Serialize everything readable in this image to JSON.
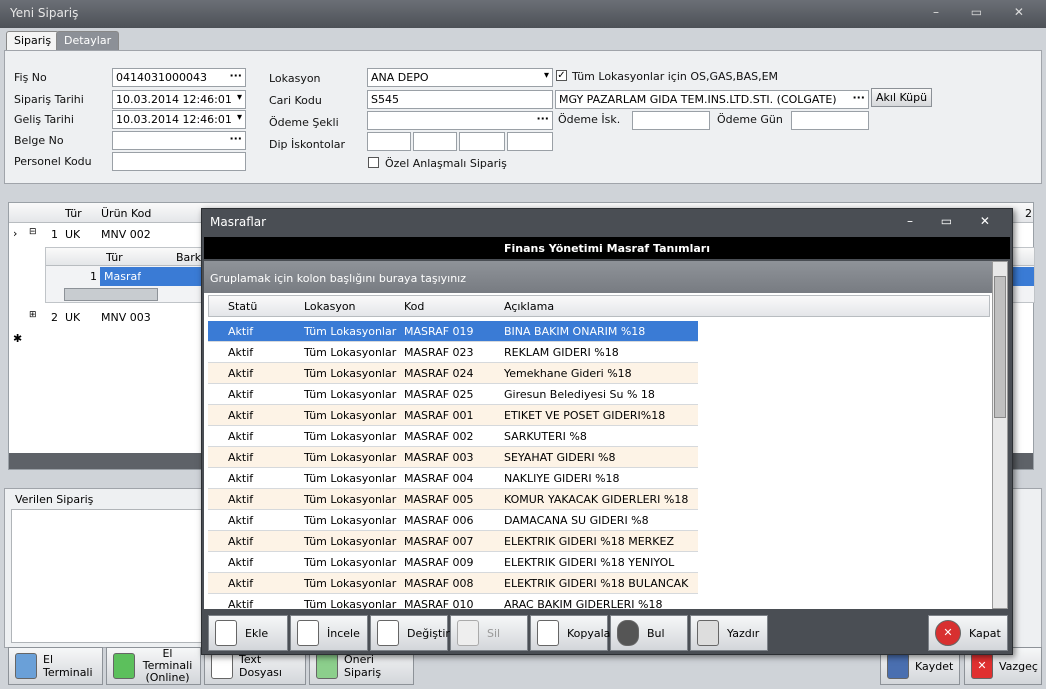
{
  "window": {
    "title": "Yeni Sipariş"
  },
  "tabs": [
    {
      "label": "Sipariş"
    },
    {
      "label": "Detaylar"
    }
  ],
  "form": {
    "fis_no_label": "Fiş No",
    "fis_no": "0414031000043",
    "siparis_tarihi_label": "Sipariş Tarihi",
    "siparis_tarihi": "10.03.2014 12:46:01",
    "gelis_tarihi_label": "Geliş Tarihi",
    "gelis_tarihi": "10.03.2014 12:46:01",
    "belge_no_label": "Belge No",
    "belge_no": "",
    "personel_kodu_label": "Personel Kodu",
    "personel_kodu": "",
    "lokasyon_label": "Lokasyon",
    "lokasyon": "ANA DEPO",
    "cari_kodu_label": "Cari Kodu",
    "cari_kodu": "S545",
    "cari_unvan": "MGY PAZARLAM GIDA TEM.INS.LTD.STI. (COLGATE)",
    "odeme_sekli_label": "Ödeme Şekli",
    "odeme_sekli": "",
    "dip_iskontolar_label": "Dip İskontolar",
    "tum_lokasyonlar_label": "Tüm Lokasyonlar için OS,GAS,BAS,EM",
    "tum_lokasyonlar_checked": true,
    "ozel_anlasmali_label": "Özel Anlaşmalı Sipariş",
    "ozel_anlasmali_checked": false,
    "akil_kupu_label": "Akıl Küpü",
    "odeme_isk_label": "Ödeme İsk.",
    "odeme_gun_label": "Ödeme Gün"
  },
  "order_grid": {
    "headers": [
      "Tür",
      "Ürün Kod"
    ],
    "rows": [
      {
        "no": "1",
        "tur": "UK",
        "kod": "MNV 002"
      },
      {
        "no": "2",
        "tur": "UK",
        "kod": "MNV 003"
      }
    ],
    "sub_headers": [
      "Tür",
      "Bark"
    ],
    "sub_row": {
      "no": "1",
      "tur": "Masraf"
    },
    "right_header": "2"
  },
  "verilen_siparis_label": "Verilen Sipariş",
  "bottom_buttons": {
    "el_terminali": "El Terminali",
    "el_terminali_online_1": "El Terminali",
    "el_terminali_online_2": "(Online)",
    "text_dosyasi": "Text Dosyası",
    "oneri_siparis": "Öneri Sipariş",
    "kaydet": "Kaydet",
    "vazgec": "Vazgeç"
  },
  "modal": {
    "title": "Masraflar",
    "banner": "Finans Yönetimi Masraf Tanımları",
    "group_hint": "Gruplamak için kolon başlığını buraya taşıyınız",
    "columns": [
      "Statü",
      "Lokasyon",
      "Kod",
      "Açıklama"
    ],
    "rows": [
      [
        "Aktif",
        "Tüm Lokasyonlar",
        "MASRAF 019",
        "BINA BAKIM ONARIM %18"
      ],
      [
        "Aktif",
        "Tüm Lokasyonlar",
        "MASRAF 023",
        "REKLAM GIDERI %18"
      ],
      [
        "Aktif",
        "Tüm Lokasyonlar",
        "MASRAF 024",
        "Yemekhane Gideri %18"
      ],
      [
        "Aktif",
        "Tüm Lokasyonlar",
        "MASRAF 025",
        "Giresun Belediyesi Su % 18"
      ],
      [
        "Aktif",
        "Tüm Lokasyonlar",
        "MASRAF 001",
        "ETIKET VE POSET GIDERI%18"
      ],
      [
        "Aktif",
        "Tüm Lokasyonlar",
        "MASRAF 002",
        "SARKUTERI %8"
      ],
      [
        "Aktif",
        "Tüm Lokasyonlar",
        "MASRAF 003",
        "SEYAHAT GIDERI %8"
      ],
      [
        "Aktif",
        "Tüm Lokasyonlar",
        "MASRAF 004",
        "NAKLIYE GIDERI %18"
      ],
      [
        "Aktif",
        "Tüm Lokasyonlar",
        "MASRAF 005",
        "KOMUR YAKACAK GIDERLERI %18"
      ],
      [
        "Aktif",
        "Tüm Lokasyonlar",
        "MASRAF 006",
        "DAMACANA SU GIDERI %8"
      ],
      [
        "Aktif",
        "Tüm Lokasyonlar",
        "MASRAF 007",
        "ELEKTRIK GIDERI %18 MERKEZ"
      ],
      [
        "Aktif",
        "Tüm Lokasyonlar",
        "MASRAF 009",
        "ELEKTRIK GIDERI %18 YENIYOL"
      ],
      [
        "Aktif",
        "Tüm Lokasyonlar",
        "MASRAF 008",
        "ELEKTRIK GIDERI %18 BULANCAK"
      ],
      [
        "Aktif",
        "Tüm Lokasyonlar",
        "MASRAF 010",
        "ARAC BAKIM GIDERLERI %18"
      ]
    ],
    "buttons": {
      "ekle": "Ekle",
      "incele": "İncele",
      "degistir": "Değiştir",
      "sil": "Sil",
      "kopyala": "Kopyala",
      "bul": "Bul",
      "yazdir": "Yazdır",
      "kapat": "Kapat"
    }
  }
}
